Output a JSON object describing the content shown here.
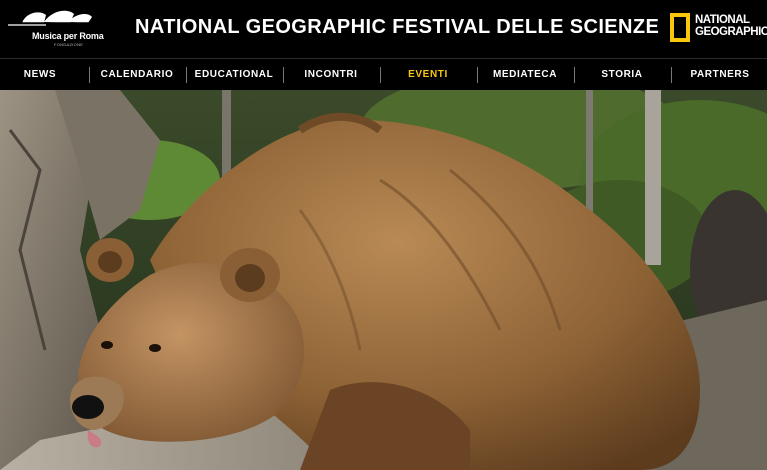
{
  "header": {
    "partner_logo": {
      "name": "Musica per Roma",
      "sub": "FONDAZIONE",
      "icon": "auditorium-roofs-icon"
    },
    "title": "NATIONAL GEOGRAPHIC FESTIVAL DELLE SCIENZE",
    "ng_logo": {
      "line1": "NATIONAL",
      "line2": "GEOGRAPHIC",
      "icon": "yellow-frame-icon",
      "color": "#f9c80e"
    }
  },
  "nav": {
    "items": [
      {
        "label": "NEWS",
        "active": false
      },
      {
        "label": "CALENDARIO",
        "active": false
      },
      {
        "label": "EDUCATIONAL",
        "active": false
      },
      {
        "label": "INCONTRI",
        "active": false
      },
      {
        "label": "EVENTI",
        "active": true
      },
      {
        "label": "MEDIATECA",
        "active": false
      },
      {
        "label": "STORIA",
        "active": false
      },
      {
        "label": "PARTNERS",
        "active": false
      }
    ],
    "active_color": "#f9c80e"
  },
  "hero": {
    "subject": "brown bear resting on a log"
  }
}
